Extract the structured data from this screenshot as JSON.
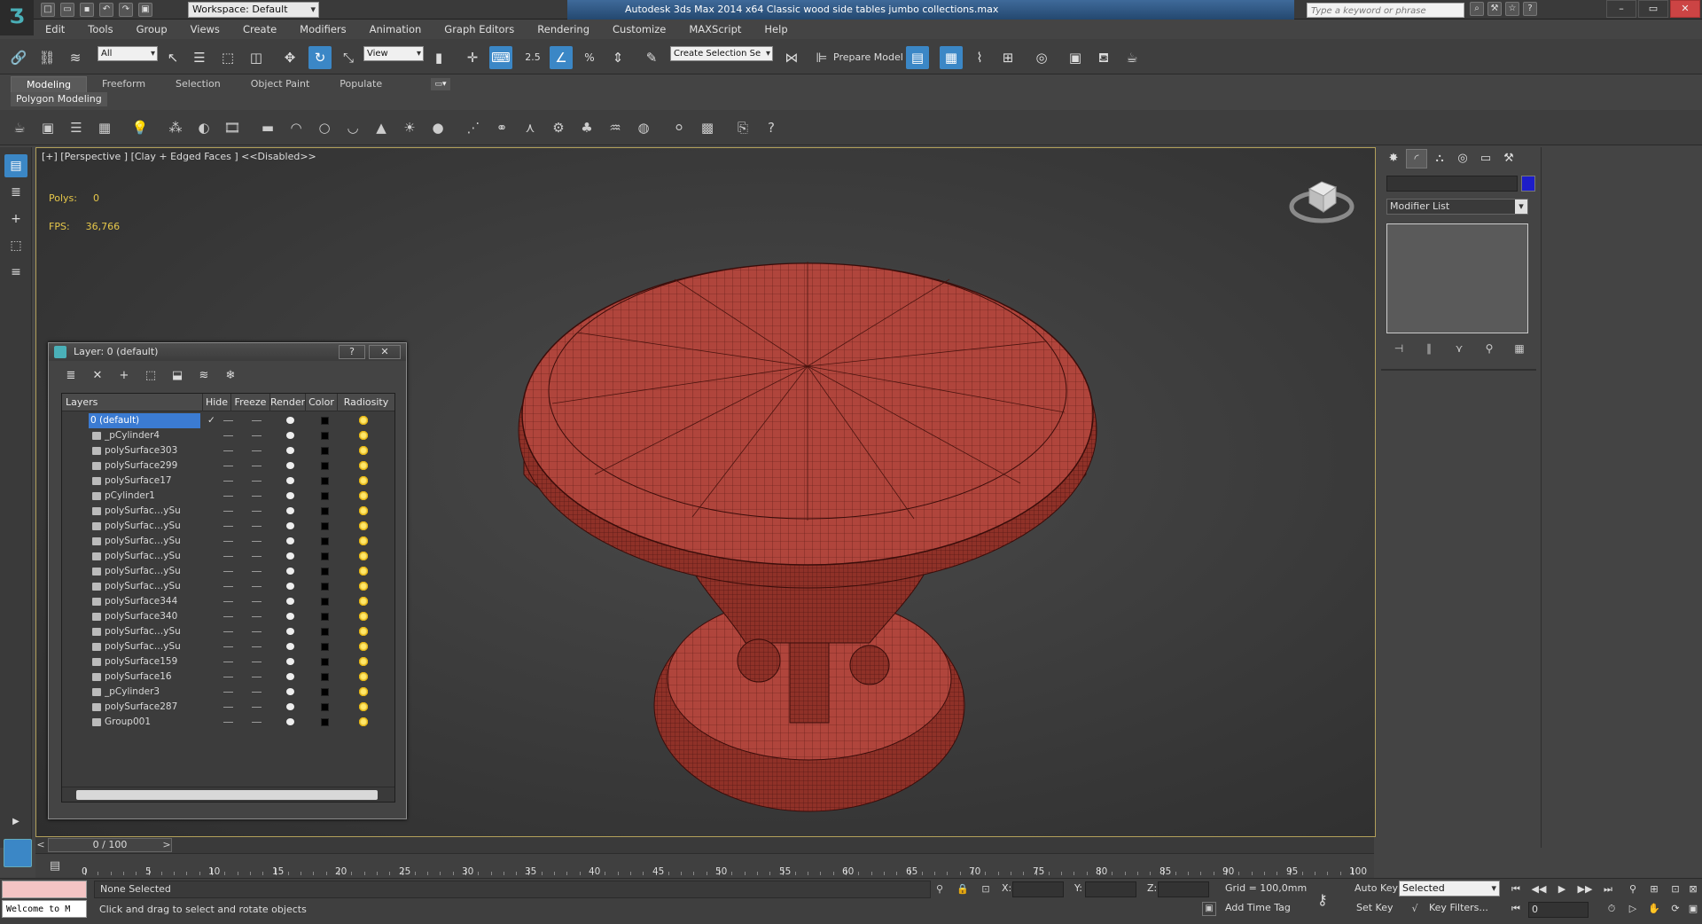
{
  "app": {
    "window_title": "Autodesk 3ds Max  2014 x64     Classic wood side tables  jumbo collections.max",
    "workspace": "Workspace: Default",
    "search_placeholder": "Type a keyword or phrase"
  },
  "menu": [
    "Edit",
    "Tools",
    "Group",
    "Views",
    "Create",
    "Modifiers",
    "Animation",
    "Graph Editors",
    "Rendering",
    "Customize",
    "MAXScript",
    "Help"
  ],
  "toolbar": {
    "selection_filter": "All",
    "ref_coord": "View",
    "snap_value": "2.5",
    "named_selection": "Create Selection Se",
    "prepare_model": "Prepare Model"
  },
  "ribbon": {
    "tabs": [
      "Modeling",
      "Freeform",
      "Selection",
      "Object Paint",
      "Populate"
    ],
    "active_tab": "Modeling",
    "panel_label": "Polygon Modeling"
  },
  "viewport": {
    "label": "[+] [Perspective ] [Clay + Edged Faces ]  <<Disabled>>",
    "polys_label": "Polys:",
    "polys_value": "0",
    "fps_label": "FPS:",
    "fps_value": "36,766",
    "model_color": "#b0453c"
  },
  "layer_dialog": {
    "title": "Layer: 0 (default)",
    "help": "?",
    "close": "✕",
    "columns": [
      "Layers",
      "Hide",
      "Freeze",
      "Render",
      "Color",
      "Radiosity"
    ],
    "rows": [
      {
        "name": "0 (default)",
        "selected": true,
        "check": "✓"
      },
      {
        "name": "_pCylinder4"
      },
      {
        "name": "polySurface303"
      },
      {
        "name": "polySurface299"
      },
      {
        "name": "polySurface17"
      },
      {
        "name": "pCylinder1"
      },
      {
        "name": "polySurfac…ySu"
      },
      {
        "name": "polySurfac…ySu"
      },
      {
        "name": "polySurfac…ySu"
      },
      {
        "name": "polySurfac…ySu"
      },
      {
        "name": "polySurfac…ySu"
      },
      {
        "name": "polySurfac…ySu"
      },
      {
        "name": "polySurface344"
      },
      {
        "name": "polySurface340"
      },
      {
        "name": "polySurfac…ySu"
      },
      {
        "name": "polySurfac…ySu"
      },
      {
        "name": "polySurface159"
      },
      {
        "name": "polySurface16"
      },
      {
        "name": "_pCylinder3"
      },
      {
        "name": "polySurface287"
      },
      {
        "name": "Group001"
      }
    ]
  },
  "command_panel": {
    "modifier_list": "Modifier List",
    "object_color": "#1d1dc9"
  },
  "timeline": {
    "frame_display": "0 / 100",
    "tick_labels": [
      "0",
      "5",
      "10",
      "15",
      "20",
      "25",
      "30",
      "35",
      "40",
      "45",
      "50",
      "55",
      "60",
      "65",
      "70",
      "75",
      "80",
      "85",
      "90",
      "95",
      "100"
    ]
  },
  "status": {
    "maxscript": "Welcome to M",
    "selection": "None Selected",
    "prompt": "Click and drag to select and rotate objects",
    "x_label": "X:",
    "y_label": "Y:",
    "z_label": "Z:",
    "grid": "Grid = 100,0mm",
    "add_time_tag": "Add Time Tag",
    "auto_key": "Auto Key",
    "set_key": "Set Key",
    "key_mode": "Selected",
    "key_filters": "Key Filters...",
    "current_frame": "0"
  }
}
